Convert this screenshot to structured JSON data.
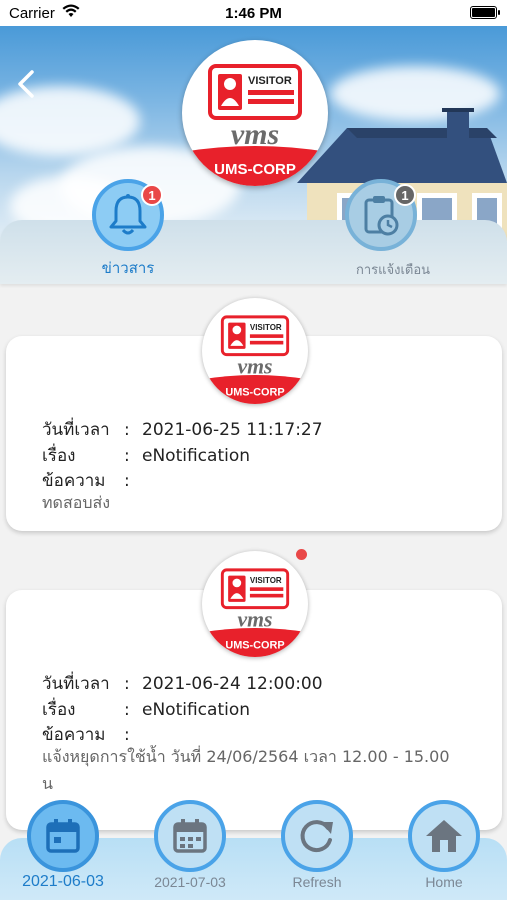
{
  "status_bar": {
    "carrier": "Carrier",
    "time": "1:46 PM"
  },
  "logo": {
    "top_text": "VISITOR",
    "middle_text": "vms",
    "bottom_text": "UMS-CORP"
  },
  "tabs": [
    {
      "label": "ข่าวสาร",
      "badge": "1",
      "icon": "bell-icon",
      "active": true
    },
    {
      "label": "การแจ้งเตือน",
      "badge": "1",
      "icon": "clipboard-clock-icon",
      "active": false
    }
  ],
  "field_labels": {
    "datetime": "วันที่เวลา",
    "subject": "เรื่อง",
    "message": "ข้อความ",
    "colon": ":"
  },
  "notifications": [
    {
      "datetime": "2021-06-25 11:17:27",
      "subject": "eNotification",
      "message": "ทดสอบส่ง",
      "unread": false
    },
    {
      "datetime": "2021-06-24 12:00:00",
      "subject": "eNotification",
      "message": "แจ้งหยุดการใช้น้ำ วันที่ 24/06/2564 เวลา 12.00 - 15.00 น",
      "unread": true
    }
  ],
  "bottom_nav": [
    {
      "label": "2021-06-03",
      "icon": "calendar-icon",
      "active": true
    },
    {
      "label": "2021-07-03",
      "icon": "calendar-icon",
      "active": false
    },
    {
      "label": "Refresh",
      "icon": "refresh-icon",
      "active": false
    },
    {
      "label": "Home",
      "icon": "home-icon",
      "active": false
    }
  ],
  "colors": {
    "accent": "#1d7cc9",
    "badge": "#e94848",
    "logo_red": "#e8212b"
  }
}
